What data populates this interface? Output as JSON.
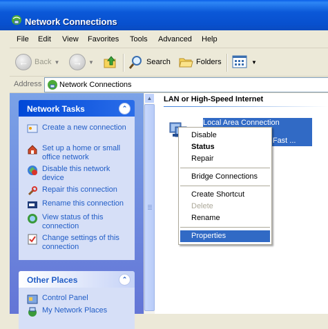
{
  "window": {
    "title": "Network Connections"
  },
  "menubar": [
    "File",
    "Edit",
    "View",
    "Favorites",
    "Tools",
    "Advanced",
    "Help"
  ],
  "toolbar": {
    "back": "Back",
    "search": "Search",
    "folders": "Folders"
  },
  "address": {
    "label": "Address",
    "value": "Network Connections"
  },
  "network_tasks": {
    "title": "Network Tasks",
    "items": [
      {
        "label": "Create a new connection",
        "icon": "new-connection-icon"
      },
      {
        "label": "Set up a home or small office network",
        "icon": "home-network-icon"
      },
      {
        "label": "Disable this network device",
        "icon": "disable-device-icon"
      },
      {
        "label": "Repair this connection",
        "icon": "repair-icon"
      },
      {
        "label": "Rename this connection",
        "icon": "rename-icon"
      },
      {
        "label": "View status of this connection",
        "icon": "status-icon"
      },
      {
        "label": "Change settings of this connection",
        "icon": "settings-icon"
      }
    ]
  },
  "other_places": {
    "title": "Other Places",
    "items": [
      {
        "label": "Control Panel",
        "icon": "control-panel-icon"
      },
      {
        "label": "My Network Places",
        "icon": "network-places-icon"
      }
    ]
  },
  "main": {
    "section": "LAN or High-Speed Internet",
    "connection": {
      "name": "Local Area Connection",
      "device": "cted Fast ..."
    }
  },
  "context_menu": {
    "items": [
      "Disable",
      "Status",
      "Repair",
      "Bridge Connections",
      "Create Shortcut",
      "Delete",
      "Rename",
      "Properties"
    ],
    "selected": "Properties",
    "disabled": [
      "Delete"
    ],
    "default": "Status"
  },
  "colors": {
    "selection": "#316AC5",
    "link": "#215DC6",
    "titlebar": "#0A4BC0"
  }
}
